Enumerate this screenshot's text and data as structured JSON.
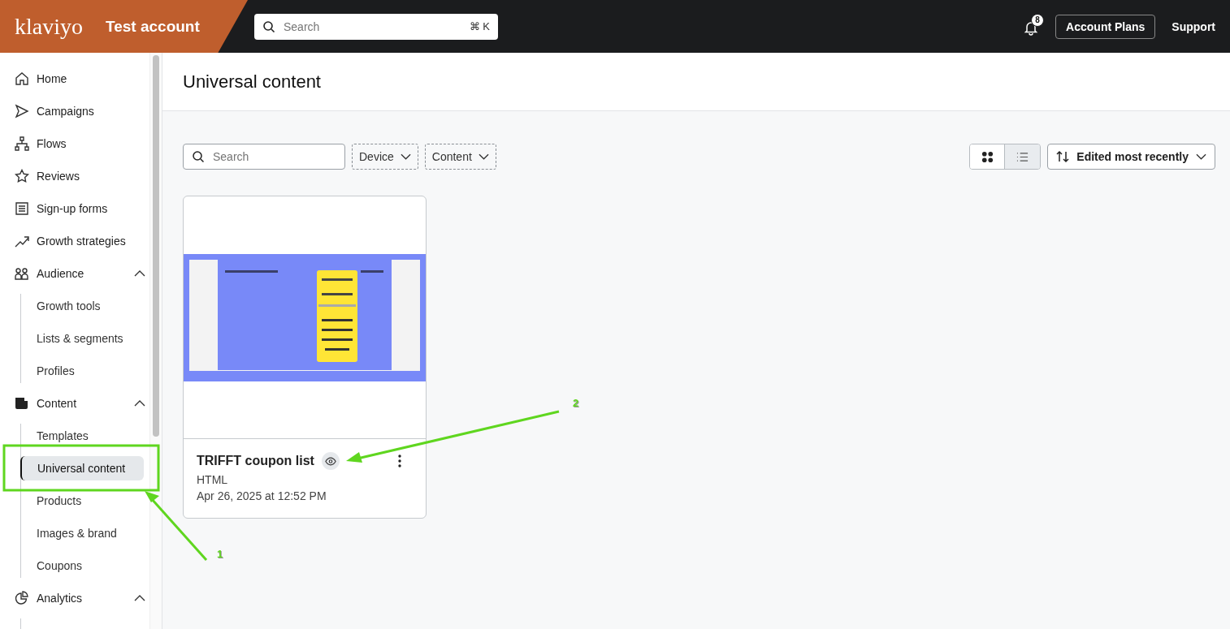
{
  "header": {
    "logo": "klaviyo",
    "account": "Test account",
    "search": {
      "placeholder": "Search",
      "shortcut": "⌘ K"
    },
    "notifications": "8",
    "buttons": [
      "Account Plans",
      "Support"
    ]
  },
  "sidebar": {
    "items": [
      {
        "label": "Home",
        "selected": false
      },
      {
        "label": "Campaigns",
        "selected": false
      },
      {
        "label": "Flows",
        "selected": false
      },
      {
        "label": "Reviews",
        "selected": false
      },
      {
        "label": "Sign-up forms",
        "selected": false
      },
      {
        "label": "Growth strategies",
        "selected": false
      },
      {
        "label": "Audience",
        "selected": false,
        "expanded": true,
        "children": [
          {
            "label": "Growth tools",
            "selected": false
          },
          {
            "label": "Lists & segments",
            "selected": false
          },
          {
            "label": "Profiles",
            "selected": false
          }
        ]
      },
      {
        "label": "Content",
        "selected": false,
        "expanded": true,
        "children": [
          {
            "label": "Templates",
            "selected": false
          },
          {
            "label": "Universal content",
            "selected": true
          },
          {
            "label": "Products",
            "selected": false
          },
          {
            "label": "Images & brand",
            "selected": false
          },
          {
            "label": "Coupons",
            "selected": false
          }
        ]
      },
      {
        "label": "Analytics",
        "selected": false,
        "expanded": true
      }
    ]
  },
  "page": {
    "title": "Universal content",
    "toolbar": {
      "search": {
        "placeholder": "Search"
      },
      "filters": [
        "Device",
        "Content"
      ],
      "views": [
        {
          "kind": "grid",
          "selected": true
        },
        {
          "kind": "list",
          "selected": false
        }
      ],
      "sort": "Edited most recently"
    },
    "cards": [
      {
        "name": "TRIFFT coupon list",
        "type": "HTML",
        "date": "Apr 26, 2025 at 12:52 PM"
      }
    ]
  },
  "annotations": [
    {
      "label": "1"
    },
    {
      "label": "2"
    }
  ]
}
